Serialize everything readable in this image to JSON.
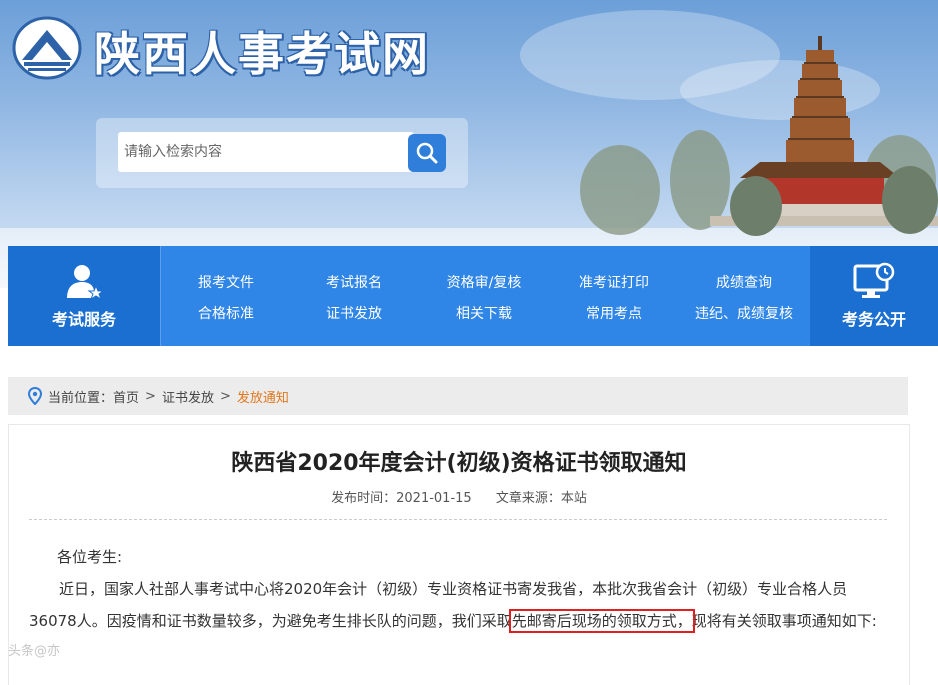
{
  "site": {
    "title": "陕西人事考试网"
  },
  "search": {
    "placeholder": "请输入检索内容"
  },
  "nav": {
    "left": {
      "label": "考试服务",
      "icon": "user-star-icon"
    },
    "right": {
      "label": "考务公开",
      "icon": "monitor-clock-icon"
    },
    "links": [
      "报考文件",
      "考试报名",
      "资格审/复核",
      "准考证打印",
      "成绩查询",
      "合格标准",
      "证书发放",
      "相关下载",
      "常用考点",
      "违纪、成绩复核"
    ]
  },
  "breadcrumb": {
    "prefix": "当前位置：",
    "items": [
      "首页",
      "证书发放",
      "发放通知"
    ],
    "separator": ">"
  },
  "article": {
    "title": "陕西省2020年度会计(初级)资格证书领取通知",
    "publish_label": "发布时间：2021-01-15",
    "source_label": "文章来源：本站",
    "salutation": "各位考生:",
    "para1_a": "近日，国家人社部人事考试中心将2020年会计（初级）专业资格证书寄发我省，本批次我省会计（初级）专业合格人员36078人。因疫情和证书数量较多，为避免考生排长队的问题，我们采取",
    "para1_highlight": "先邮寄后现场的领取方式，",
    "para1_b": "现将有关领取事项通知如下:"
  },
  "watermark": "头条@亦"
}
